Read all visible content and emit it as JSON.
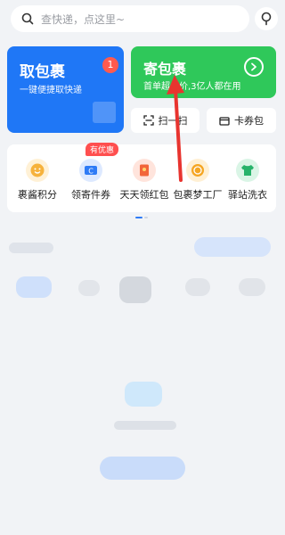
{
  "search": {
    "placeholder": "查快递，点这里~"
  },
  "cards": {
    "pickup": {
      "title": "取包裹",
      "subtitle": "一键便捷取快递",
      "badge": "1"
    },
    "send": {
      "title": "寄包裹",
      "subtitle": "首单超值价,3亿人都在用"
    }
  },
  "actions": {
    "scan": "扫一扫",
    "coupon": "卡券包"
  },
  "shortcuts": [
    {
      "label": "裹酱积分",
      "icon": "smiley-coin-icon",
      "color": "#f6b23c"
    },
    {
      "label": "领寄件券",
      "icon": "ticket-icon",
      "color": "#2e7bf6"
    },
    {
      "label": "天天领红包",
      "icon": "red-packet-icon",
      "color": "#f2653a"
    },
    {
      "label": "包裹梦工厂",
      "icon": "coin-icon",
      "color": "#f5a623"
    },
    {
      "label": "驿站洗衣",
      "icon": "shirt-icon",
      "color": "#27b36a"
    }
  ],
  "promo_tag": "有优惠",
  "colors": {
    "blue_card": "#1f77f6",
    "green_card": "#2fc85a",
    "badge": "#ff5a4e",
    "arrow": "#e8342f"
  }
}
